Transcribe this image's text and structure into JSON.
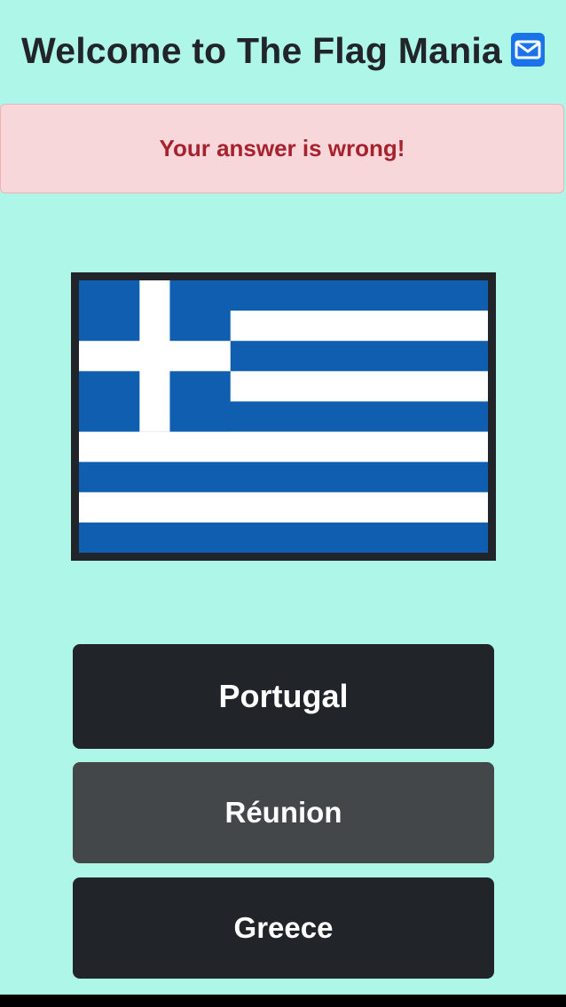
{
  "header": {
    "title": "Welcome to The Flag Mania",
    "icon": "envelope-icon",
    "icon_color": "#1a73e8"
  },
  "alert": {
    "message": "Your answer is wrong!",
    "background": "#f8d7da",
    "text_color": "#a6222e"
  },
  "flag": {
    "icon": "flag-of-greece",
    "colors": {
      "blue": "#105eb0",
      "white": "#ffffff",
      "frame": "#212529"
    }
  },
  "answers": [
    {
      "label": "Portugal"
    },
    {
      "label": "Réunion"
    },
    {
      "label": "Greece"
    }
  ]
}
